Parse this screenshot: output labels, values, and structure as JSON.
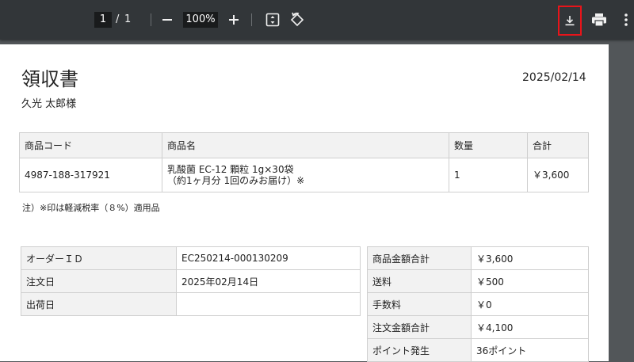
{
  "toolbar": {
    "page_current": "1",
    "page_separator": "/",
    "page_total": "1",
    "zoom_level": "100%",
    "icons": [
      "minus-icon",
      "plus-icon",
      "fit-page-icon",
      "rotate-icon",
      "download-icon",
      "print-icon",
      "more-vert-icon"
    ],
    "highlight_color": "#e8141a"
  },
  "document": {
    "title": "領収書",
    "date": "2025/02/14",
    "customer": "久光 太郎様",
    "items_headers": [
      "商品コード",
      "商品名",
      "数量",
      "合計"
    ],
    "items": [
      {
        "code": "4987-188-317921",
        "name_line1": "乳酸菌 EC-12 顆粒 1g×30袋",
        "name_line2": "（約1ヶ月分 1回のみお届け）※",
        "qty": "1",
        "total": "￥3,600"
      }
    ],
    "note": "注）※印は軽減税率（８%）適用品",
    "order_info": [
      {
        "label": "オーダーＩＤ",
        "value": "EC250214-000130209"
      },
      {
        "label": "注文日",
        "value": "2025年02月14日"
      },
      {
        "label": "出荷日",
        "value": ""
      }
    ],
    "totals": [
      {
        "label": "商品金額合計",
        "value": "￥3,600"
      },
      {
        "label": "送料",
        "value": "￥500"
      },
      {
        "label": "手数料",
        "value": "￥0"
      },
      {
        "label": "注文金額合計",
        "value": "￥4,100"
      },
      {
        "label": "ポイント発生",
        "value": "36ポイント"
      }
    ]
  }
}
